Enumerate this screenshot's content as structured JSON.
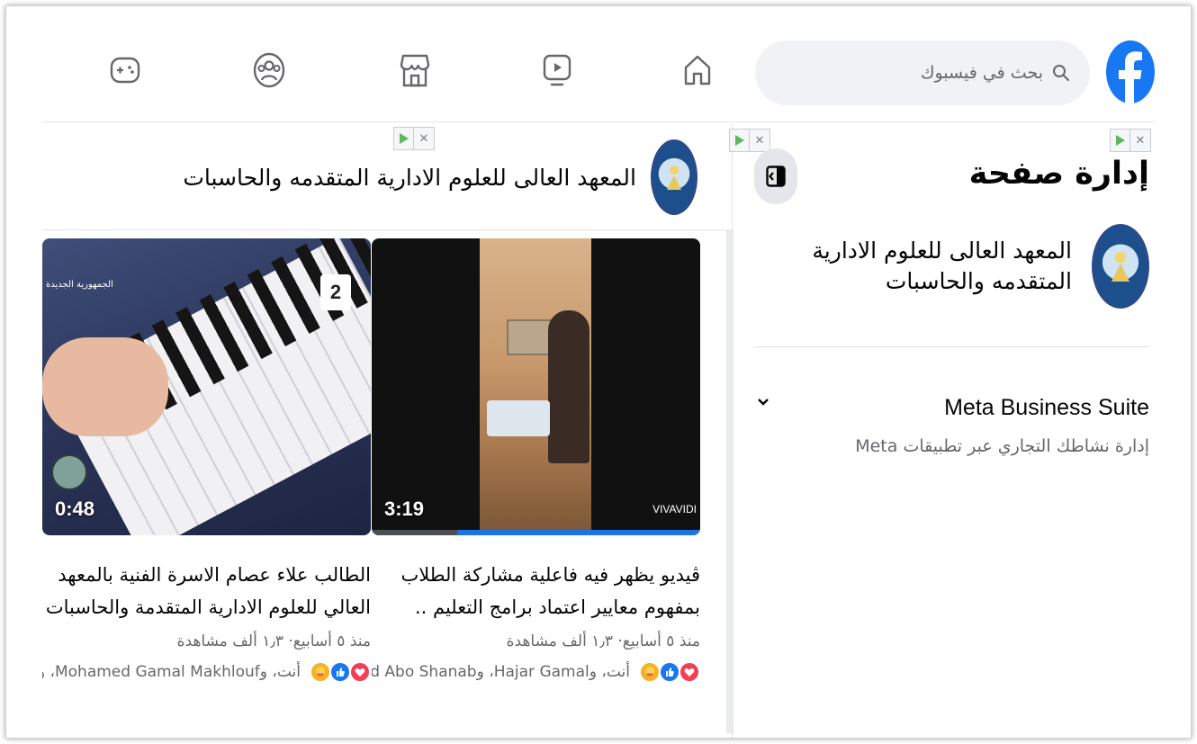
{
  "header": {
    "search_placeholder": "بحث في فيسبوك",
    "icons": [
      "facebook-logo",
      "home-icon",
      "video-icon",
      "marketplace-icon",
      "groups-icon",
      "gaming-icon"
    ],
    "brand_color": "#1877f2"
  },
  "sidebar": {
    "title": "إدارة صفحة",
    "page_name": "المعهد العالى للعلوم الادارية المتقدمه والحاسبات",
    "business_suite": {
      "title": "Meta Business Suite",
      "subtitle": "إدارة نشاطك التجاري عبر تطبيقات Meta"
    }
  },
  "feed": {
    "page_name": "المعهد العالى للعلوم الادارية المتقدمه والحاسبات",
    "videos": [
      {
        "duration": "3:19",
        "watermark": "VIVAVIDI",
        "title": "ڤيديو يظهر فيه فاعلية مشاركة الطلاب بمفهوم معايير اعتماد برامج التعليم ..",
        "meta": "منذ ٥ أسابيع· ١٫٣ ألف مشاهدة",
        "reactions_text": "أنت، وHajar Gamal، وMohamed Abo Shanab",
        "progress": 0.74
      },
      {
        "duration": "0:48",
        "title": "الطالب علاء عصام الاسرة الفنية بالمعهد العالي للعلوم الادارية المتقدمة والحاسبات",
        "meta": "منذ ٥ أسابيع· ١٫٣ ألف مشاهدة",
        "reactions_text": "أنت، وMohamed Gamal Makhlouf، و",
        "channel_badge": "2",
        "channel_label": "الجمهورية الجديدة"
      }
    ]
  }
}
